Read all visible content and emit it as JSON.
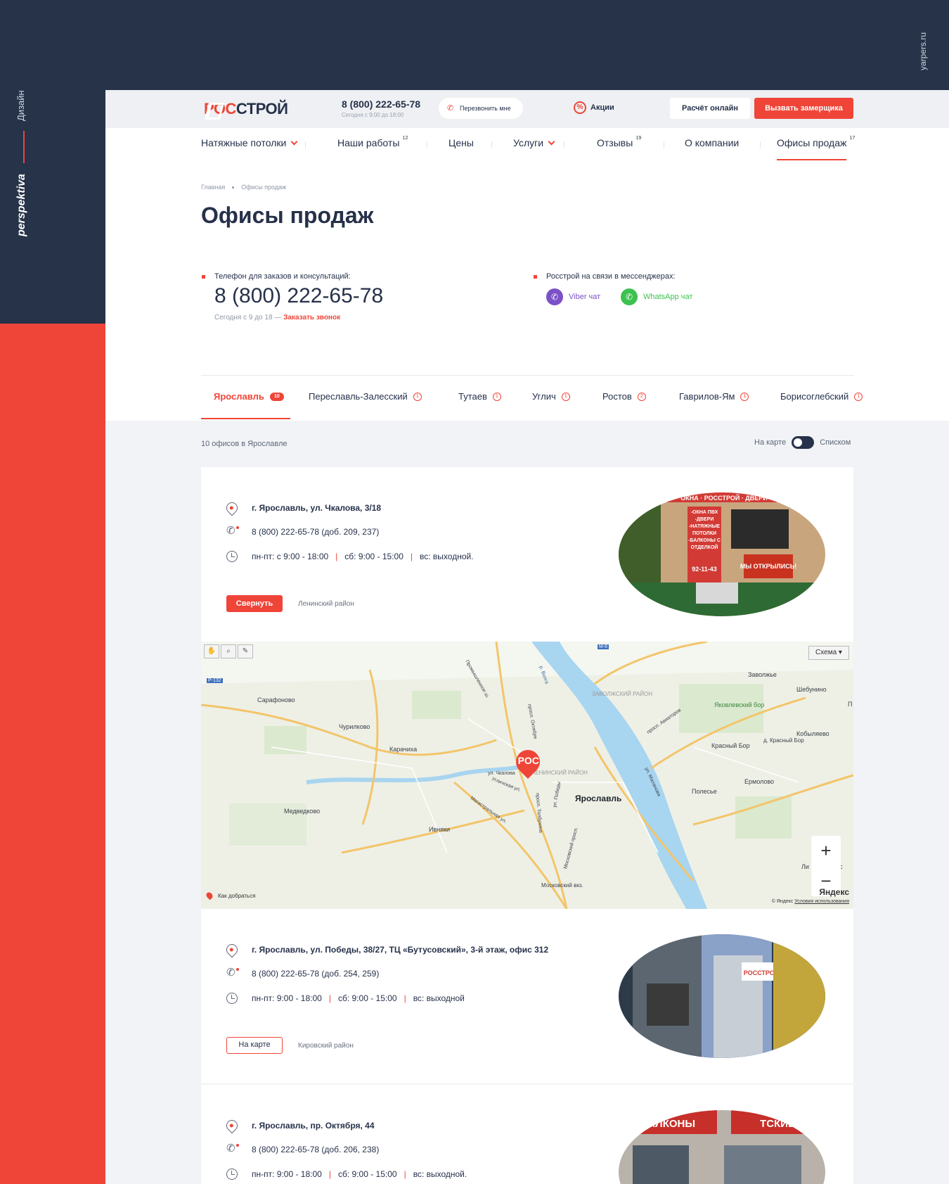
{
  "frame": {
    "side_design": "Дизайн",
    "side_brand": "perspektiva",
    "top_url": "yarpers.ru"
  },
  "header": {
    "logo_part1": "РОС",
    "logo_part2": "СТРОЙ",
    "phone": "8 (800) 222-65-78",
    "phone_hours": "Сегодня с 9:00 до 18:00",
    "callback": "Перезвонить мне",
    "promo": "Акции",
    "calc_button": "Расчёт онлайн",
    "call_button": "Вызвать замерщика"
  },
  "nav": {
    "items": [
      {
        "label": "Натяжные потолки",
        "badge": ""
      },
      {
        "label": "Наши работы",
        "badge": "12"
      },
      {
        "label": "Цены",
        "badge": ""
      },
      {
        "label": "Услуги",
        "badge": ""
      },
      {
        "label": "Отзывы",
        "badge": "19"
      },
      {
        "label": "О компании",
        "badge": ""
      },
      {
        "label": "Офисы продаж",
        "badge": "17"
      }
    ]
  },
  "breadcrumb": [
    "Главная",
    "Офисы продаж"
  ],
  "page_title": "Офисы продаж",
  "contacts": {
    "phone_label": "Телефон для заказов и консультаций:",
    "phone": "8 (800) 222-65-78",
    "phone_note": "Сегодня с 9 до 18 —",
    "order_call": "Заказать звонок",
    "messenger_label": "Росстрой на связи в мессенджерах:",
    "viber": "Viber чат",
    "whatsapp": "WhatsApp чат",
    "viber_color": "#7b51c7",
    "whatsapp_color": "#3cc24f"
  },
  "tabs": [
    {
      "label": "Ярославль",
      "count": "10"
    },
    {
      "label": "Переславль-Залесский",
      "count": "1"
    },
    {
      "label": "Тутаев",
      "count": "1"
    },
    {
      "label": "Углич",
      "count": "1"
    },
    {
      "label": "Ростов",
      "count": "2"
    },
    {
      "label": "Гаврилов-Ям",
      "count": "1"
    },
    {
      "label": "Борисоглебский",
      "count": "1"
    }
  ],
  "list_header": {
    "count_text": "10 офисов в Ярославле",
    "on_map": "На карте",
    "as_list": "Списком"
  },
  "offices": [
    {
      "address": "г. Ярославль, ул. Чкалова, 3/18",
      "phone": "8 (800) 222-65-78 (доб. 209, 237)",
      "hours": [
        "пн-пт: с 9:00 - 18:00",
        "сб: 9:00 - 15:00",
        "вс: выходной."
      ],
      "button": "Свернуть",
      "district": "Ленинский район"
    },
    {
      "address": "г. Ярославль, ул. Победы, 38/27, ТЦ «Бутусовский», 3-й этаж, офис 312",
      "phone": "8 (800) 222-65-78 (доб. 254, 259)",
      "hours": [
        "пн-пт: 9:00 - 18:00",
        "сб: 9:00 - 15:00",
        "вс: выходной"
      ],
      "button": "На карте",
      "district": "Кировский район"
    },
    {
      "address": "г. Ярославль, пр. Октября, 44",
      "phone": "8 (800) 222-65-78 (доб. 206, 238)",
      "hours": [
        "пн-пт: 9:00 - 18:00",
        "сб: 9:00 - 15:00",
        "вс: выходной."
      ]
    }
  ],
  "photos": {
    "office1_sign": "ОКНА · РОССТРОЙ · ДВЕРИ",
    "office1_panel": "-ОКНА ПВХ -ДВЕРИ -НАТЯЖНЫЕ ПОТОЛКИ -БАЛКОНЫ С ОТДЕЛКОЙ",
    "office1_phone": "92-11-43",
    "office1_banner": "МЫ ОТКРЫЛИСЬ!",
    "office2_sign": "РОССТРОЙ",
    "office3_sign_left": "БАЛКОНЫ",
    "office3_sign_right": "ТСКИЕ"
  },
  "map": {
    "scheme": "Схема",
    "marker": "РОС",
    "city": "Ярославль",
    "route": "Как добраться",
    "brand": "Яндекс",
    "copyright": "© Яндекс",
    "terms": "Условия использования",
    "labels": [
      "Сарафоново",
      "Чурилково",
      "Карачиха",
      "Медведково",
      "Ивняки",
      "Заволжье",
      "Шебунино",
      "Яковлевский бор",
      "Красный Бор",
      "д. Красный Бор",
      "Кобыляево",
      "Ермолово",
      "Полесье",
      "ЗАВОЛЖСКИЙ РАЙОН",
      "ЛЕНИНСКИЙ РАЙОН",
      "ул. Чкалова",
      "просп. Октября",
      "просп. Авиаторов",
      "Московский вкз.",
      "Р-132",
      "М-8",
      "Промышленное ш.",
      "Угличская ул.",
      "Магистральная ул.",
      "просп. Толбухина",
      "ул. Победы",
      "Московский просп.",
      "ул. Маланова",
      "р. Волга",
      "Ли",
      "с",
      "П"
    ]
  }
}
